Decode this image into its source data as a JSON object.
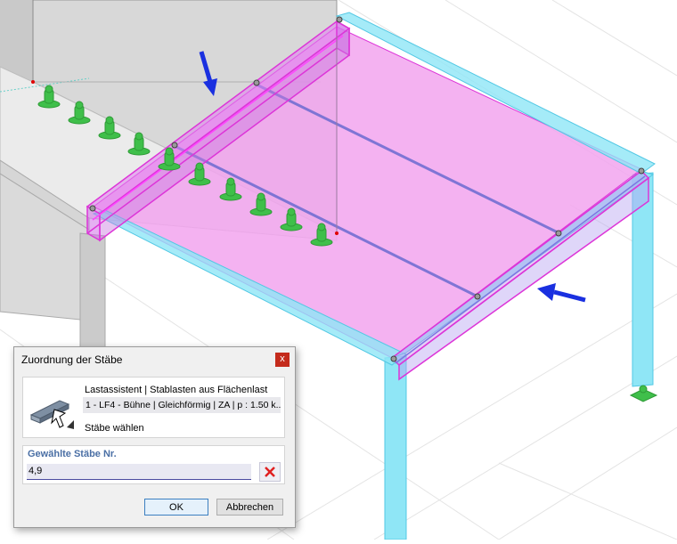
{
  "dialog": {
    "title": "Zuordnung der Stäbe",
    "close_glyph": "x",
    "assistant_title": "Lastassistent | Stablasten aus Flächenlast",
    "load_case_value": "1 - LF4 - Bühne | Gleichförmig | ZA | p : 1.50 k...",
    "select_members_label": "Stäbe wählen",
    "selected_section_label": "Gewählte Stäbe Nr.",
    "selected_members_value": "4,9",
    "ok_label": "OK",
    "cancel_label": "Abbrechen"
  },
  "viewport": {
    "member_color": "#8fe6f6",
    "surface_color": "#f2a4ee",
    "selection_color": "#dd35d8",
    "support_color": "#44bb44",
    "arrow_color": "#1a30e0"
  }
}
